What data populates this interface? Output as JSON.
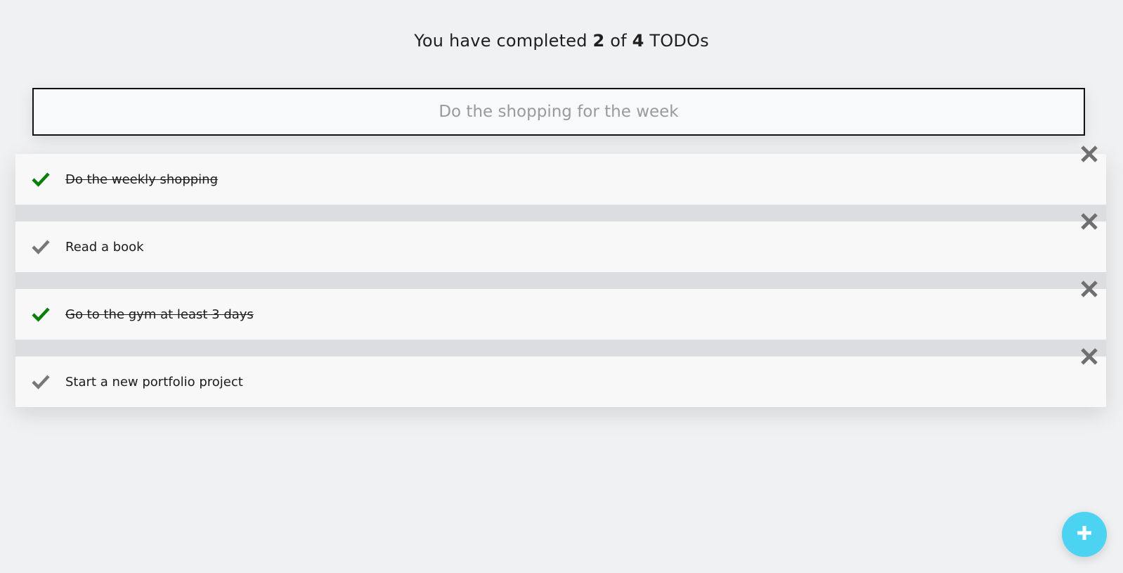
{
  "header": {
    "prefix": "You have completed",
    "completed": "2",
    "middle": "of",
    "total": "4",
    "suffix": "TODOs"
  },
  "new_todo": {
    "placeholder": "Do the shopping for the week",
    "value": ""
  },
  "todos": [
    {
      "text": "Do the weekly shopping",
      "done": true,
      "check_icon": "check-icon",
      "remove_icon": "close-icon"
    },
    {
      "text": "Read a book",
      "done": false,
      "check_icon": "check-icon",
      "remove_icon": "close-icon"
    },
    {
      "text": "Go to the gym at least 3 days",
      "done": true,
      "check_icon": "check-icon",
      "remove_icon": "close-icon"
    },
    {
      "text": "Start a new portfolio project",
      "done": false,
      "check_icon": "check-icon",
      "remove_icon": "close-icon"
    }
  ],
  "fab": {
    "icon": "plus-icon"
  },
  "colors": {
    "background": "#f0f1f3",
    "check_done": "#0a7d0a",
    "check_pending": "#777777",
    "remove": "#6f6f6f",
    "fab": "#4dd3f2"
  }
}
